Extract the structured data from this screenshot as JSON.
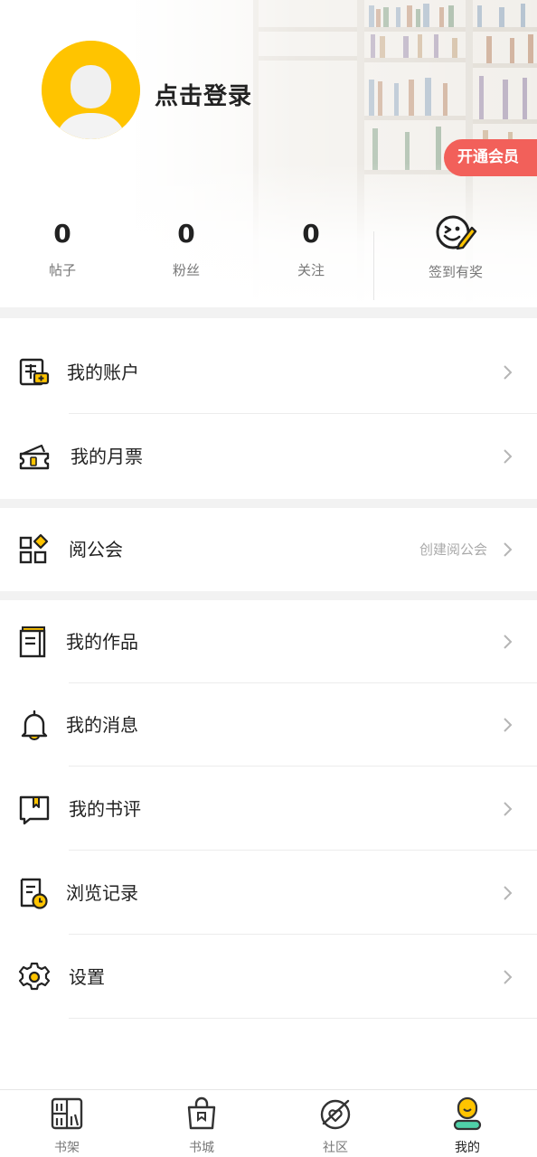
{
  "profile": {
    "login_prompt": "点击登录",
    "vip_button": "开通会员"
  },
  "stats": [
    {
      "value": "0",
      "label": "帖子"
    },
    {
      "value": "0",
      "label": "粉丝"
    },
    {
      "value": "0",
      "label": "关注"
    }
  ],
  "checkin": {
    "label": "签到有奖",
    "icon": "smile-pencil-icon"
  },
  "menu": {
    "account": {
      "label": "我的账户",
      "icon": "wallet-icon"
    },
    "monthly_ticket": {
      "label": "我的月票",
      "icon": "ticket-icon"
    },
    "guild": {
      "label": "阅公会",
      "extra": "创建阅公会",
      "icon": "apps-icon"
    },
    "works": {
      "label": "我的作品",
      "icon": "book-icon"
    },
    "messages": {
      "label": "我的消息",
      "icon": "bell-icon"
    },
    "reviews": {
      "label": "我的书评",
      "icon": "bookmark-icon"
    },
    "history": {
      "label": "浏览记录",
      "icon": "history-icon"
    },
    "settings": {
      "label": "设置",
      "icon": "gear-icon"
    }
  },
  "tabs": [
    {
      "label": "书架",
      "icon": "bookshelf-icon"
    },
    {
      "label": "书城",
      "icon": "shopping-bag-icon"
    },
    {
      "label": "社区",
      "icon": "community-icon"
    },
    {
      "label": "我的",
      "icon": "me-icon",
      "active": true
    }
  ],
  "colors": {
    "accent_yellow": "#ffc400",
    "vip_red": "#f2605a",
    "text_dark": "#222222",
    "text_gray": "#777777",
    "section_gap": "#f2f2f2"
  }
}
